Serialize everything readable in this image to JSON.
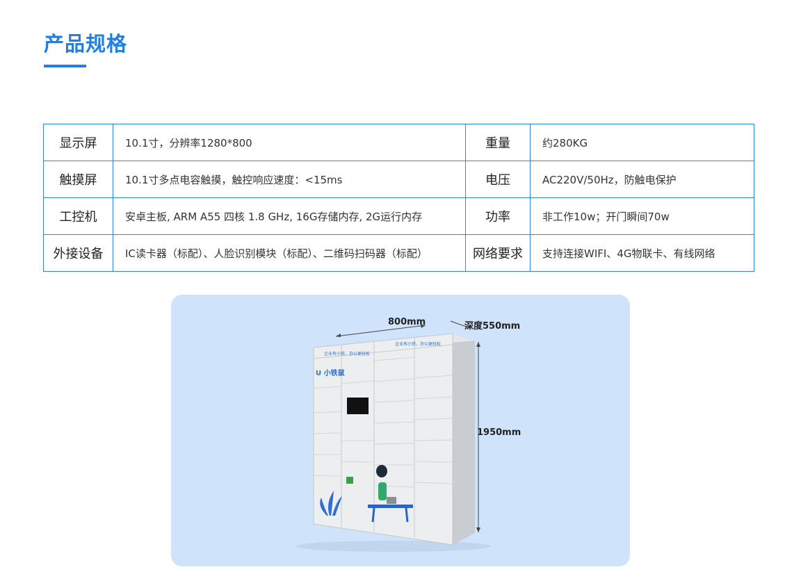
{
  "title": "产品规格",
  "specs": [
    {
      "label1": "显示屏",
      "value1": "10.1寸，分辨率1280*800",
      "label2": "重量",
      "value2": "约280KG"
    },
    {
      "label1": "触摸屏",
      "value1": "10.1寸多点电容触摸，触控响应速度：<15ms",
      "label2": "电压",
      "value2": "AC220V/50Hz，防触电保护"
    },
    {
      "label1": "工控机",
      "value1": "安卓主板, ARM A55 四核 1.8 GHz, 16G存储内存, 2G运行内存",
      "label2": "功率",
      "value2": "非工作10w；开门瞬间70w"
    },
    {
      "label1": "外接设备",
      "value1": "IC读卡器（标配）、人脸识别模块（标配）、二维码扫码器（标配）",
      "label2": "网络要求",
      "value2": "支持连接WIFI、4G物联卡、有线网络"
    }
  ],
  "product_image": {
    "width_label": "800mm",
    "depth_label": "深度550mm",
    "height_label": "1950mm",
    "slogan_left": "企业有小铁，办公更轻松",
    "slogan_right": "企业有小铁，办公更轻松",
    "brand": "小铁鼠"
  }
}
